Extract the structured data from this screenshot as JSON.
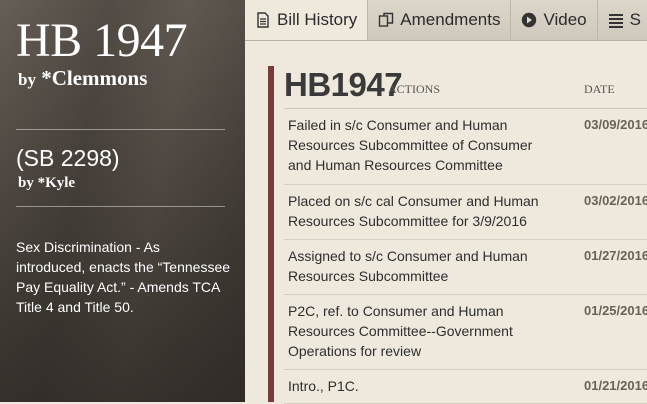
{
  "bill": {
    "number": "HB 1947",
    "sponsor_prefix": "by",
    "sponsor": "*Clemmons",
    "companion": "(SB 2298)",
    "companion_sponsor_prefix": "by",
    "companion_sponsor": "*Kyle",
    "summary": "Sex Discrimination - As introduced, enacts the “Tennessee Pay Equality Act.” - Amends TCA Title 4 and Title 50."
  },
  "tabs": [
    {
      "label": "Bill History",
      "icon": "document-icon",
      "active": true
    },
    {
      "label": "Amendments",
      "icon": "copy-icon",
      "active": false
    },
    {
      "label": "Video",
      "icon": "play-icon",
      "active": false
    },
    {
      "label": "S",
      "icon": "list-icon",
      "active": false
    }
  ],
  "history": {
    "title": "HB1947",
    "actions_label": "ACTIONS",
    "date_label": "DATE",
    "rows": [
      {
        "action": "Failed in s/c Consumer and Human Resources Subcommittee of Consumer and Human Resources Committee",
        "date": "03/09/2016"
      },
      {
        "action": "Placed on s/c cal Consumer and Human Resources Subcommittee for 3/9/2016",
        "date": "03/02/2016"
      },
      {
        "action": "Assigned to s/c Consumer and Human Resources Subcommittee",
        "date": "01/27/2016"
      },
      {
        "action": "P2C, ref. to Consumer and Human Resources Committee--Government Operations for review",
        "date": "01/25/2016"
      },
      {
        "action": "Intro., P1C.",
        "date": "01/21/2016"
      }
    ]
  },
  "colors": {
    "accent": "#7a3b3b",
    "background": "#efe9dd",
    "tab_bar": "#d7d1c6"
  }
}
